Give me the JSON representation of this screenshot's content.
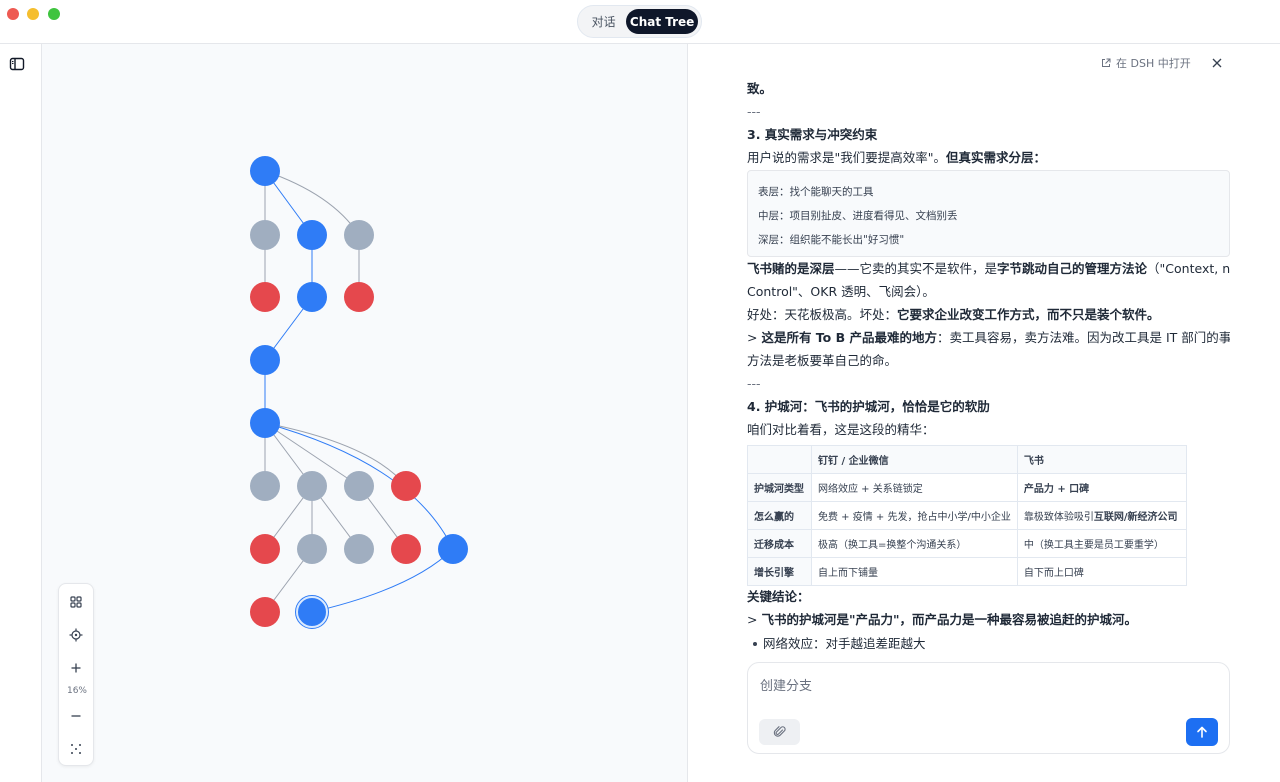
{
  "window": {
    "tabs": [
      {
        "label": "对话",
        "active": false
      },
      {
        "label": "Chat Tree",
        "active": true
      }
    ]
  },
  "zoom": {
    "level": "16%"
  },
  "panel": {
    "open_in_dsh": "在 DSH 中打开",
    "content": {
      "line_1": "致。",
      "sep_1": "---",
      "heading_3": "3. 真实需求与冲突约束",
      "intro_plain": "用户说的需求是\"我们要提高效率\"。",
      "intro_bold": "但真实需求分层：",
      "quote_lines": [
        "表层：找个能聊天的工具",
        "中层：项目别扯皮、进度看得见、文档别丢",
        "深层：组织能不能长出\"好习惯\""
      ],
      "p1_bold": "飞书赌的是深层",
      "p1_plain": "——它卖的其实不是软件，是",
      "p1_bold2": "字节跳动自己的管理方法论",
      "p1_plain2": "（\"Context, not",
      "p1_cont": "Control\"、OKR 透明、飞阅会）。",
      "p2_plain": "好处：天花板极高。坏处：",
      "p2_bold": "它要求企业改变工作方式，而不只是装个软件。",
      "p3_prefix": "> ",
      "p3_bold": "这是所有 To B 产品最难的地方",
      "p3_plain": "：卖工具容易，卖方法难。因为改工具是 IT 部门的事，改",
      "p3_cont": "方法是老板要革自己的命。",
      "sep_2": "---",
      "heading_4": "4. 护城河：飞书的护城河，恰恰是它的软肋",
      "p4": "咱们对比着看，这是这段的精华：",
      "table": {
        "headers": [
          "",
          "钉钉 / 企业微信",
          "飞书"
        ],
        "rows": [
          {
            "label": "护城河类型",
            "a": "网络效应 + 关系链锁定",
            "b": "产品力 + 口碑",
            "b_bold": true
          },
          {
            "label": "怎么赢的",
            "a": "免费 + 疫情 + 先发，抢占中小学/中小企业",
            "b_plain": "靠极致体验吸引",
            "b_bold_part": "互联网/新经济公司"
          },
          {
            "label": "迁移成本",
            "a": "极高（换工具=换整个沟通关系）",
            "b": "中（换工具主要是员工要重学）"
          },
          {
            "label": "增长引擎",
            "a": "自上而下铺量",
            "b": "自下而上口碑"
          }
        ]
      },
      "conclusion_label": "关键结论：",
      "conclusion_prefix": "> ",
      "conclusion": "飞书的护城河是\"产品力\"，而产品力是一种最容易被追赶的护城河。",
      "bullet_1": "网络效应：对手越追差距越大"
    },
    "composer": {
      "placeholder": "创建分支"
    }
  },
  "colors": {
    "node_blue": "#2f7cf6",
    "node_gray": "#a0aec0",
    "node_red": "#e5484d",
    "send_button": "#1d6ff2"
  }
}
